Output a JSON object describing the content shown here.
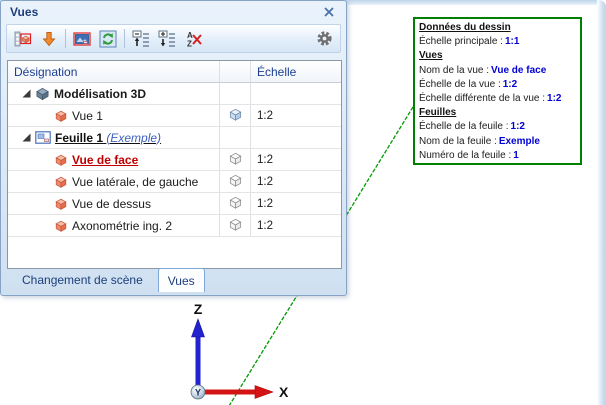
{
  "panel": {
    "title": "Vues",
    "toolbar": {
      "icons": [
        {
          "name": "new-view-icon"
        },
        {
          "name": "move-down-arrow-icon"
        },
        {
          "name": "preview-image-icon"
        },
        {
          "name": "refresh-icon"
        },
        {
          "name": "collapse-all-icon"
        },
        {
          "name": "expand-all-icon"
        },
        {
          "name": "remove-sort-az-icon"
        },
        {
          "name": "gear-icon"
        }
      ]
    },
    "columns": {
      "designation": "Désignation",
      "echelle": "Échelle"
    },
    "rows": [
      {
        "label": "Modélisation 3D",
        "scale": "",
        "icon": "model-3d-icon",
        "state_icon": ""
      },
      {
        "label": "Vue 1",
        "scale": "1:2",
        "icon": "view-cube-orange-icon",
        "state_icon": "cube-blue-icon"
      },
      {
        "label": "Feuille 1",
        "label_suffix": "(Exemple)",
        "scale": "",
        "icon": "sheet-icon",
        "state_icon": ""
      },
      {
        "label": "Vue de face",
        "scale": "1:2",
        "icon": "view-cube-orange-icon",
        "state_icon": "cube-wireframe-icon"
      },
      {
        "label": "Vue latérale, de gauche",
        "scale": "1:2",
        "icon": "view-cube-orange-icon",
        "state_icon": "cube-wireframe-icon"
      },
      {
        "label": "Vue de dessus",
        "scale": "1:2",
        "icon": "view-cube-orange-icon",
        "state_icon": "cube-wireframe-icon"
      },
      {
        "label": "Axonométrie ing. 2",
        "scale": "1:2",
        "icon": "view-cube-orange-icon",
        "state_icon": "cube-wireframe-icon"
      }
    ],
    "tabs": [
      {
        "label": "Changement de scène",
        "active": false
      },
      {
        "label": "Vues",
        "active": true
      }
    ]
  },
  "annotation": {
    "border_color": "#008000",
    "value_color": "#0000D6",
    "lines": [
      {
        "type": "heading",
        "text": "Données du dessin"
      },
      {
        "label": "Échelle principale :",
        "value": "1:1"
      },
      {
        "type": "heading",
        "text": "Vues"
      },
      {
        "label": "Nom de la vue :",
        "value": "Vue de face"
      },
      {
        "label": "Échelle de la vue :",
        "value": "1:2"
      },
      {
        "label": "Échelle différente de la vue :",
        "value": "1:2"
      },
      {
        "type": "heading",
        "text": "Feuilles"
      },
      {
        "label": "Échelle de la feuile :",
        "value": "1:2"
      },
      {
        "label": "Nom de la feuile :",
        "value": "Exemple"
      },
      {
        "label": "Numéro de la feuile :",
        "value": "1"
      }
    ]
  },
  "axes": {
    "x_label": "X",
    "y_label": "Y",
    "z_label": "Z",
    "x_color": "#D41414",
    "z_color": "#2222CE"
  },
  "leader_color": "#009900"
}
